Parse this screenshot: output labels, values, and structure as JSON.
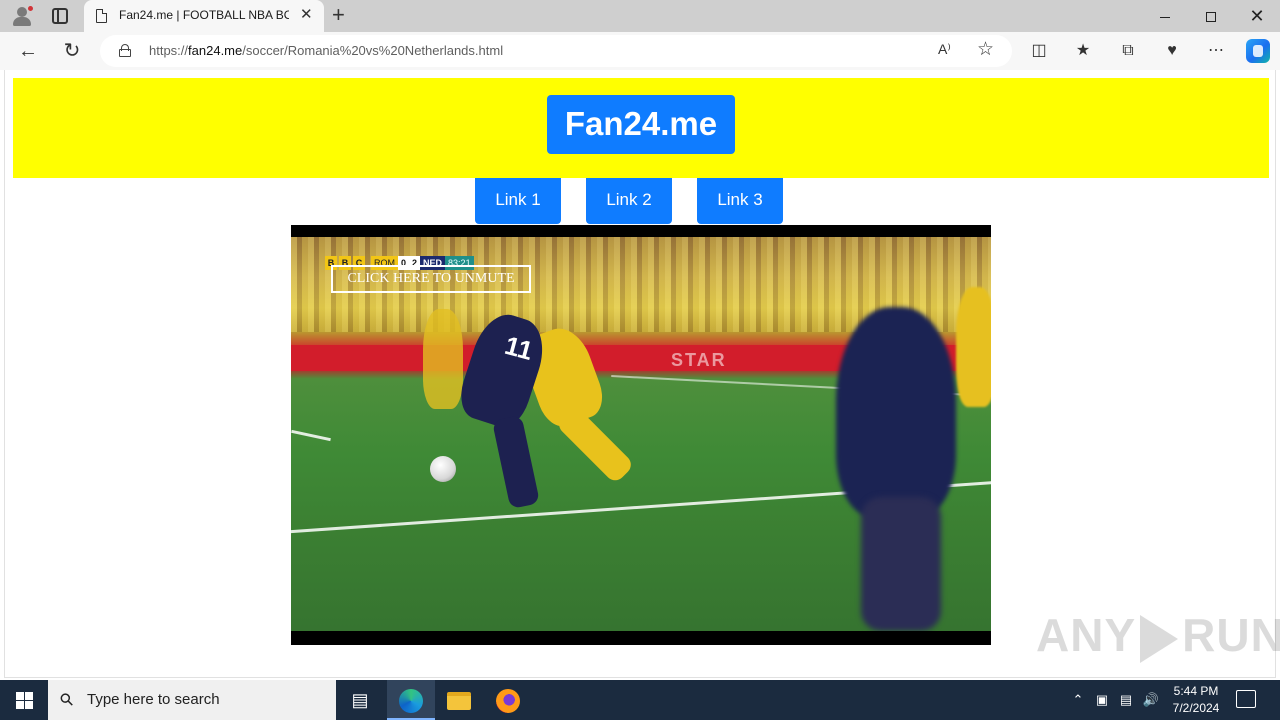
{
  "browser": {
    "tab_title": "Fan24.me | FOOTBALL NBA BOXING",
    "tab_close": "✕",
    "new_tab": "+",
    "url_prefix": "https://",
    "url_host": "fan24.me",
    "url_path": "/soccer/Romania%20vs%20Netherlands.html",
    "read_aloud": "A⁾",
    "window_close": "✕"
  },
  "site": {
    "brand": "Fan24.me",
    "links": [
      "Link 1",
      "Link 2",
      "Link 3"
    ]
  },
  "video": {
    "bbc_letters": [
      "B",
      "B",
      "C"
    ],
    "home_team": "ROM",
    "home_score": "0",
    "away_score": "2",
    "away_team": "NED",
    "match_clock": "83:21",
    "unmute_label": "CLICK HERE TO UNMUTE",
    "player_number": "11",
    "board_text": "STAR"
  },
  "watermark": {
    "left": "ANY",
    "right": "RUN"
  },
  "taskbar": {
    "search_placeholder": "Type here to search",
    "time": "5:44 PM",
    "date": "7/2/2024"
  }
}
